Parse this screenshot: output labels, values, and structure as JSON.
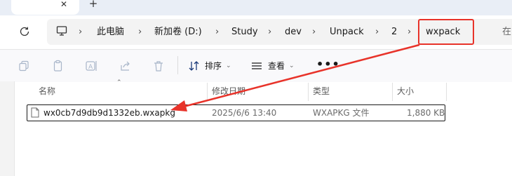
{
  "tabs": {
    "close_glyph": "✕",
    "new_glyph": "+"
  },
  "address": {
    "crumbs": [
      "此电脑",
      "新加卷 (D:)",
      "Study",
      "dev",
      "Unpack",
      "2",
      "wxpack"
    ],
    "separator": "›",
    "search_label": "在"
  },
  "toolbar": {
    "sort_label": "排序",
    "view_label": "查看",
    "more_label": "•••",
    "icons": [
      "copy-icon",
      "paste-icon",
      "rename-icon",
      "share-icon",
      "delete-icon"
    ]
  },
  "columns": {
    "name": "名称",
    "modified": "修改日期",
    "type": "类型",
    "size": "大小"
  },
  "files": [
    {
      "name": "wx0cb7d9db9d1332eb.wxapkg",
      "modified": "2025/6/6 13:40",
      "type": "WXAPKG 文件",
      "size": "1,880 KB"
    }
  ],
  "annotation": {
    "color": "#e8332a"
  }
}
